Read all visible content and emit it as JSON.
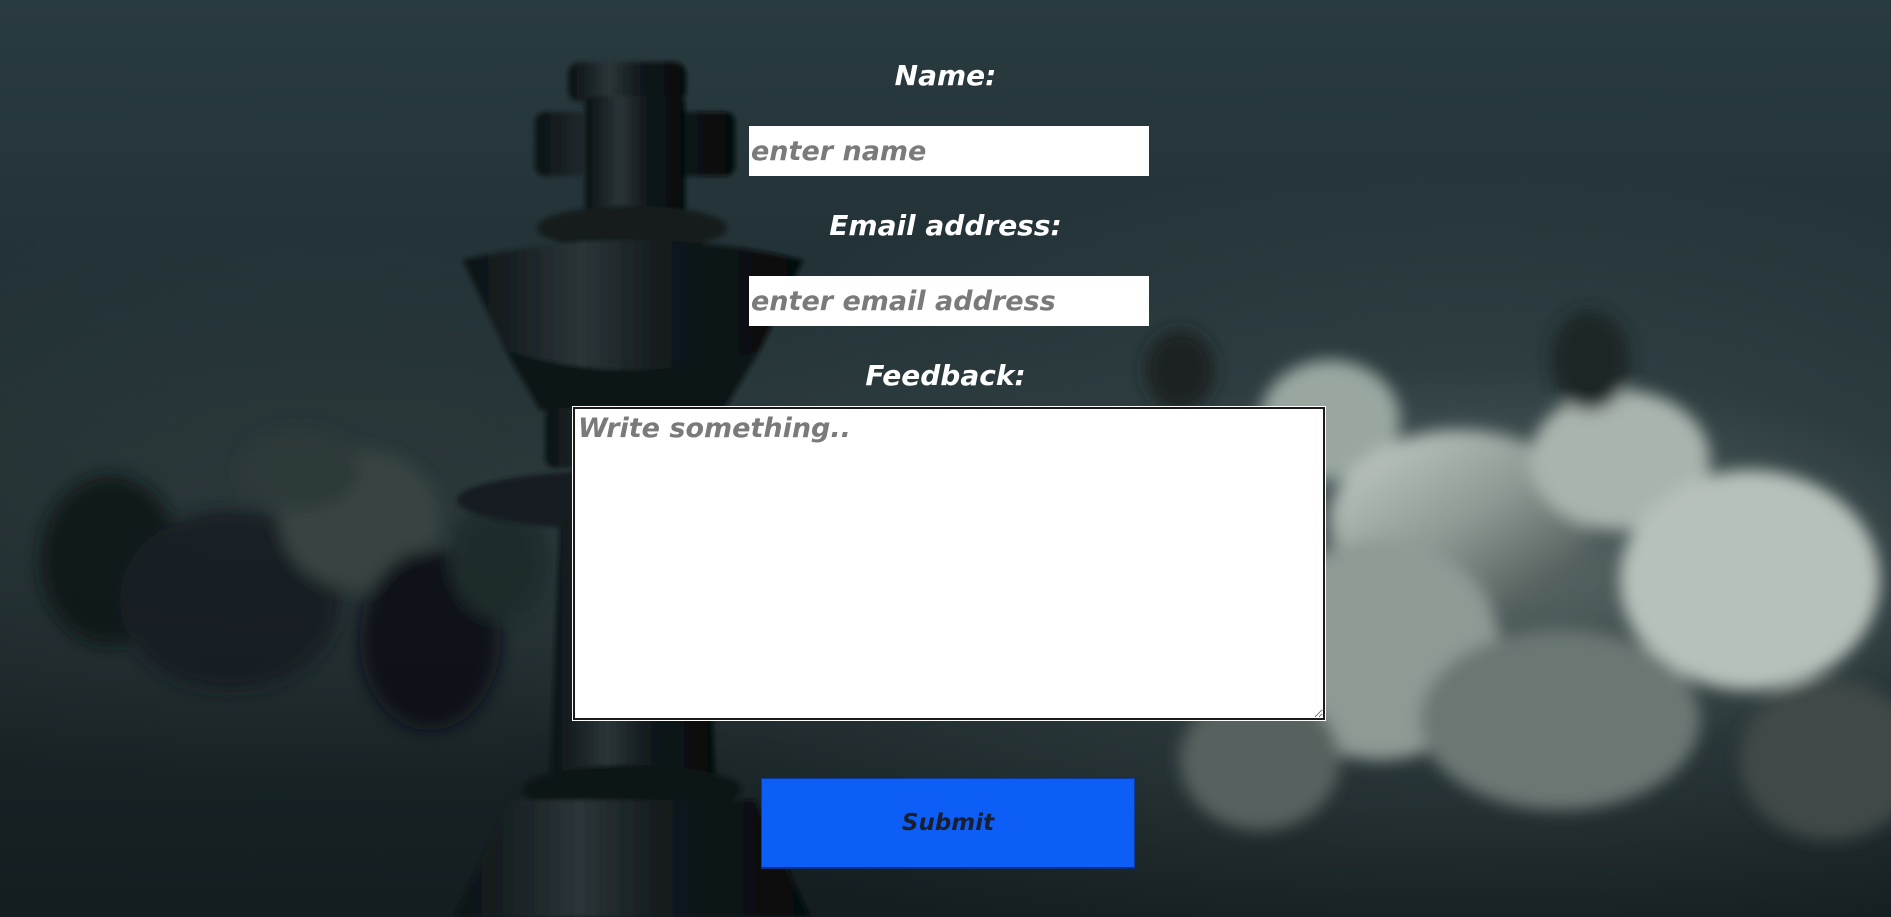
{
  "form": {
    "name_label": "Name:",
    "name_placeholder": "enter name",
    "email_label": "Email address:",
    "email_placeholder": "enter email address",
    "feedback_label": "Feedback:",
    "feedback_placeholder": "Write something..",
    "submit_label": "Submit"
  },
  "colors": {
    "background": "#1f2e32",
    "label_text": "#ffffff",
    "submit_button": "#0d5ef7",
    "input_background": "#ffffff",
    "placeholder_text": "#7a7a7a"
  }
}
